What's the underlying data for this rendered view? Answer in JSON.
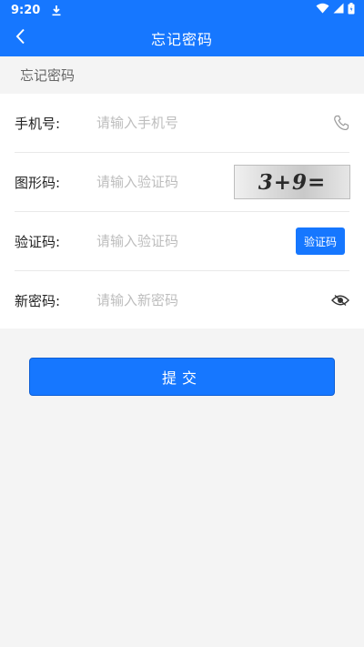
{
  "status_bar": {
    "time": "9:20",
    "icons": [
      "download-icon",
      "wifi-icon",
      "signal-icon",
      "battery-icon"
    ]
  },
  "app_bar": {
    "title": "忘记密码",
    "back_icon": "chevron-left-icon"
  },
  "section_header": "忘记密码",
  "form": {
    "phone": {
      "label": "手机号:",
      "placeholder": "请输入手机号",
      "icon": "phone-icon"
    },
    "captcha": {
      "label": "图形码:",
      "placeholder": "请输入验证码",
      "image_text": "3+9="
    },
    "sms_code": {
      "label": "验证码:",
      "placeholder": "请输入验证码",
      "button_label": "验证码"
    },
    "new_password": {
      "label": "新密码:",
      "placeholder": "请输入新密码",
      "icon": "eye-icon"
    }
  },
  "submit_label": "提交",
  "colors": {
    "primary": "#1677ff",
    "background": "#f4f4f4",
    "card": "#ffffff",
    "placeholder": "#bdbdbd"
  }
}
